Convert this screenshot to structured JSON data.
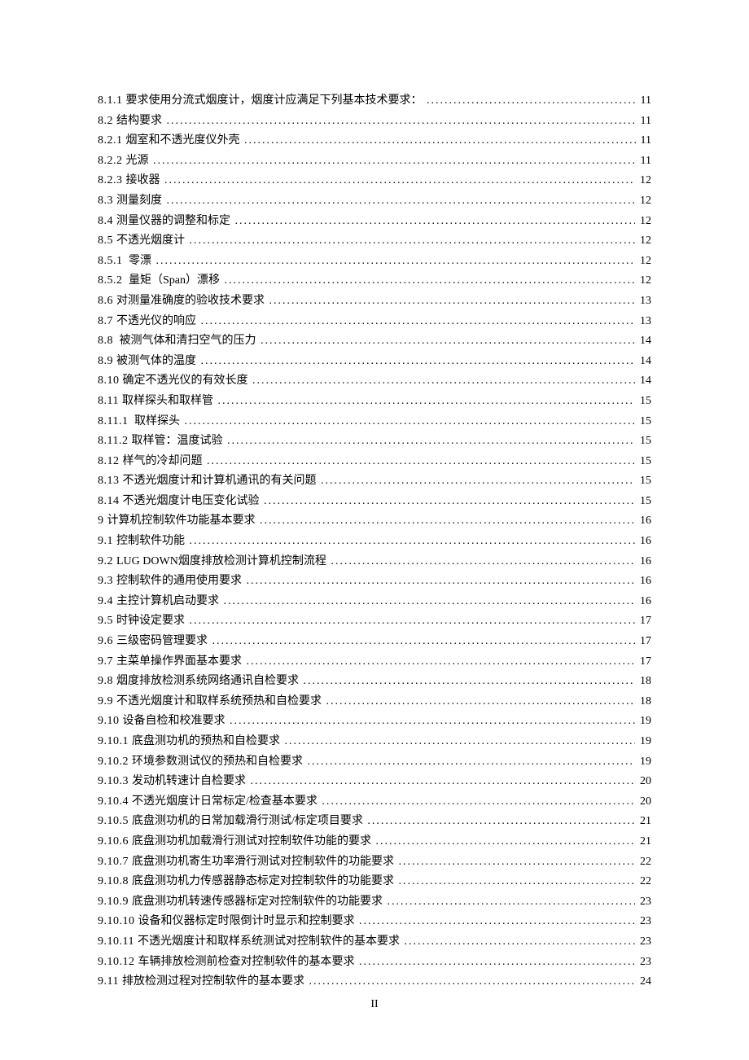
{
  "page_number": "II",
  "toc": [
    {
      "num": "8.1.1",
      "title": "要求使用分流式烟度计，烟度计应满足下列基本技术要求：",
      "page": "11"
    },
    {
      "num": "8.2",
      "title": "结构要求",
      "page": "11"
    },
    {
      "num": "8.2.1",
      "title": "烟室和不透光度仪外壳",
      "page": "11"
    },
    {
      "num": "8.2.2",
      "title": "光源",
      "page": "11"
    },
    {
      "num": "8.2.3",
      "title": "接收器",
      "page": "12"
    },
    {
      "num": "8.3",
      "title": "测量刻度",
      "page": "12"
    },
    {
      "num": "8.4",
      "title": "测量仪器的调整和标定",
      "page": "12"
    },
    {
      "num": "8.5",
      "title": "不透光烟度计",
      "page": "12"
    },
    {
      "num": "8.5.1",
      "title": " 零漂",
      "page": "12"
    },
    {
      "num": "8.5.2",
      "title": " 量矩（Span）漂移",
      "page": "12"
    },
    {
      "num": "8.6",
      "title": "对测量准确度的验收技术要求",
      "page": "13"
    },
    {
      "num": "8.7",
      "title": "不透光仪的响应",
      "page": "13"
    },
    {
      "num": "8.8",
      "title": " 被测气体和清扫空气的压力",
      "page": "14"
    },
    {
      "num": "8.9",
      "title": "被测气体的温度",
      "page": "14"
    },
    {
      "num": "8.10",
      "title": "确定不透光仪的有效长度",
      "page": "14"
    },
    {
      "num": "8.11",
      "title": "取样探头和取样管",
      "page": "15"
    },
    {
      "num": "8.11.1",
      "title": " 取样探头",
      "page": "15"
    },
    {
      "num": "8.11.2",
      "title": "取样管：温度试验",
      "page": "15"
    },
    {
      "num": "8.12",
      "title": "样气的冷却问题",
      "page": "15"
    },
    {
      "num": "8.13",
      "title": "不透光烟度计和计算机通讯的有关问题",
      "page": "15"
    },
    {
      "num": "8.14",
      "title": "不透光烟度计电压变化试验",
      "page": "15"
    },
    {
      "num": "9",
      "title": "计算机控制软件功能基本要求",
      "page": "16"
    },
    {
      "num": "9.1",
      "title": "控制软件功能",
      "page": "16"
    },
    {
      "num": "9.2",
      "title": "LUG DOWN烟度排放检测计算机控制流程",
      "page": "16"
    },
    {
      "num": "9.3",
      "title": "控制软件的通用使用要求",
      "page": "16"
    },
    {
      "num": "9.4",
      "title": "主控计算机启动要求",
      "page": "16"
    },
    {
      "num": "9.5",
      "title": "时钟设定要求",
      "page": "17"
    },
    {
      "num": "9.6",
      "title": "三级密码管理要求",
      "page": "17"
    },
    {
      "num": "9.7",
      "title": "主菜单操作界面基本要求",
      "page": "17"
    },
    {
      "num": "9.8",
      "title": "烟度排放检测系统网络通讯自检要求",
      "page": "18"
    },
    {
      "num": "9.9",
      "title": "不透光烟度计和取样系统预热和自检要求",
      "page": "18"
    },
    {
      "num": "9.10",
      "title": "设备自检和校准要求",
      "page": "19"
    },
    {
      "num": "9.10.1",
      "title": "底盘测功机的预热和自检要求",
      "page": "19"
    },
    {
      "num": "9.10.2",
      "title": "环境参数测试仪的预热和自检要求",
      "page": "19"
    },
    {
      "num": "9.10.3",
      "title": "发动机转速计自检要求",
      "page": "20"
    },
    {
      "num": "9.10.4",
      "title": "不透光烟度计日常标定/检查基本要求",
      "page": "20"
    },
    {
      "num": "9.10.5",
      "title": "底盘测功机的日常加载滑行测试/标定项目要求",
      "page": "21"
    },
    {
      "num": "9.10.6",
      "title": "底盘测功机加载滑行测试对控制软件功能的要求",
      "page": "21"
    },
    {
      "num": "9.10.7",
      "title": "底盘测功机寄生功率滑行测试对控制软件的功能要求",
      "page": "22"
    },
    {
      "num": "9.10.8",
      "title": "底盘测功机力传感器静态标定对控制软件的功能要求",
      "page": "22"
    },
    {
      "num": "9.10.9",
      "title": "底盘测功机转速传感器标定对控制软件的功能要求",
      "page": "23"
    },
    {
      "num": "9.10.10",
      "title": "设备和仪器标定时限倒计时显示和控制要求",
      "page": "23"
    },
    {
      "num": "9.10.11",
      "title": "不透光烟度计和取样系统测试对控制软件的基本要求",
      "page": "23"
    },
    {
      "num": "9.10.12",
      "title": "车辆排放检测前检查对控制软件的基本要求",
      "page": "23"
    },
    {
      "num": "9.11",
      "title": "排放检测过程对控制软件的基本要求",
      "page": "24"
    }
  ]
}
